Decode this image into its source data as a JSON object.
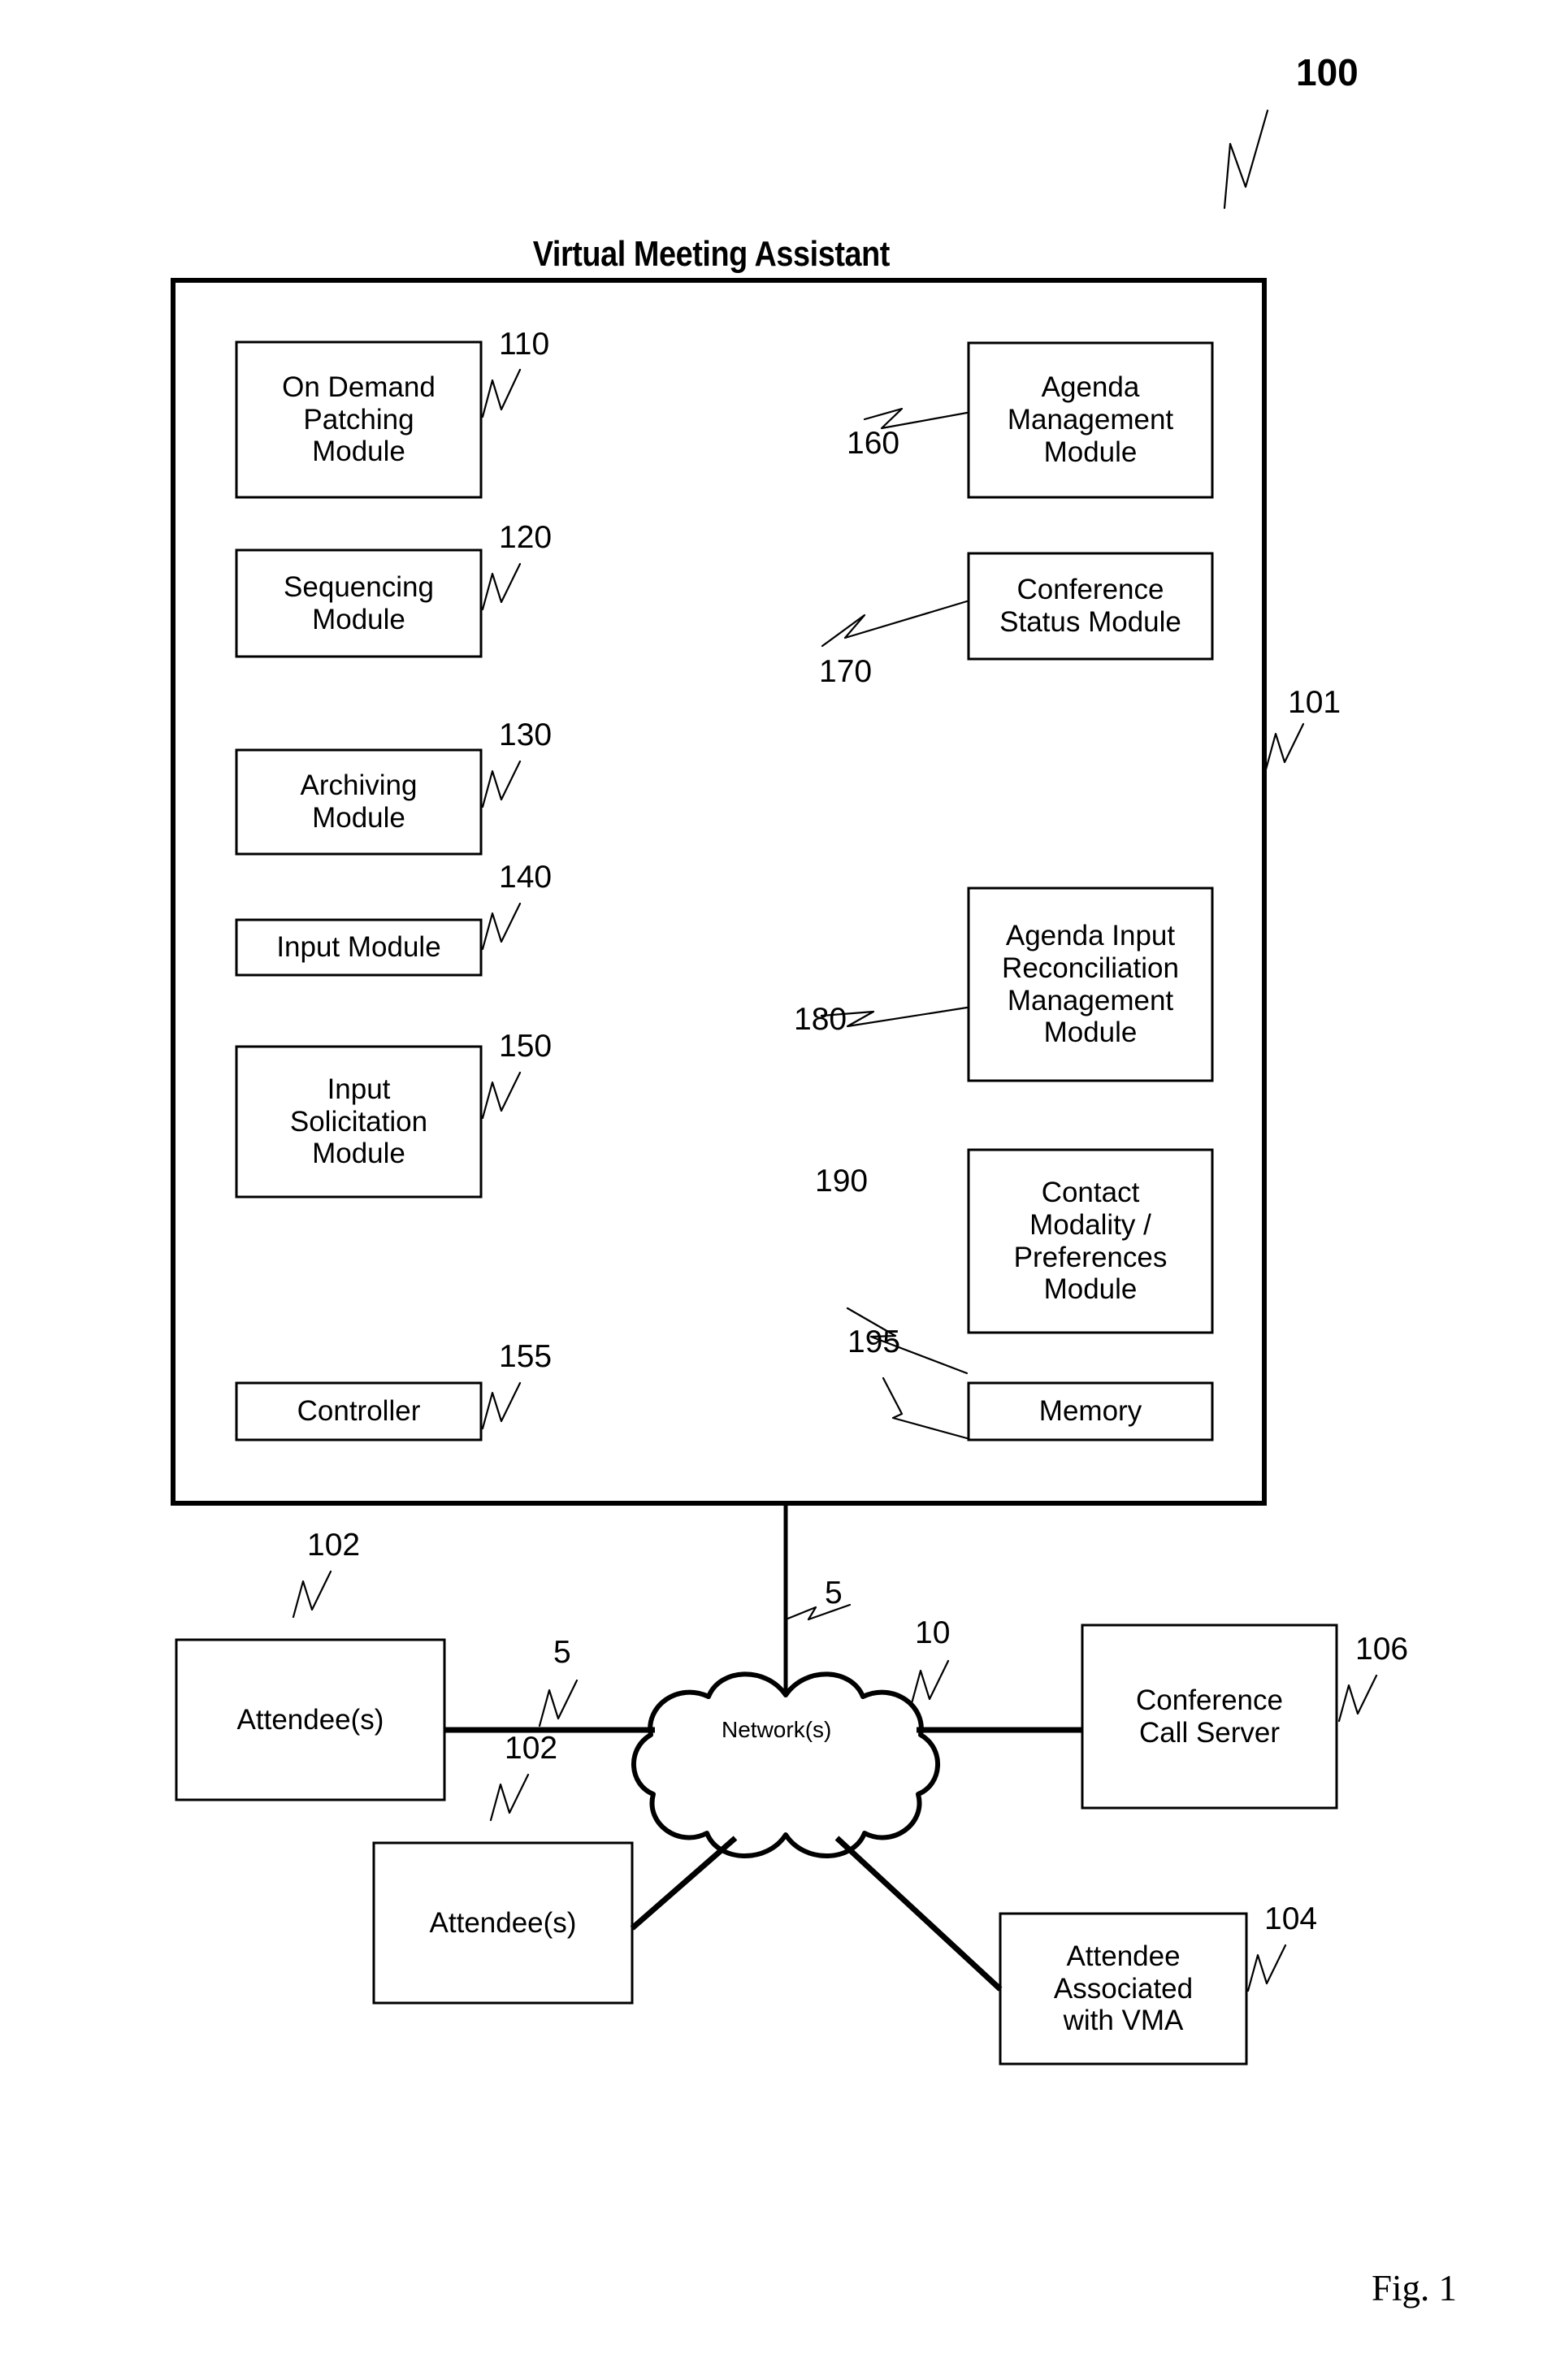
{
  "figure": {
    "caption": "Fig. 1",
    "system_ref": "100",
    "title": "Virtual Meeting Assistant"
  },
  "vma_frame": {
    "ref": "101"
  },
  "modules_left": [
    {
      "label": "On Demand\nPatching\nModule",
      "ref": "110"
    },
    {
      "label": "Sequencing\nModule",
      "ref": "120"
    },
    {
      "label": "Archiving\nModule",
      "ref": "130"
    },
    {
      "label": "Input Module",
      "ref": "140"
    },
    {
      "label": "Input\nSolicitation\nModule",
      "ref": "150"
    },
    {
      "label": "Controller",
      "ref": "155"
    }
  ],
  "modules_right": [
    {
      "label": "Agenda\nManagement\nModule",
      "ref": "160"
    },
    {
      "label": "Conference\nStatus Module",
      "ref": "170"
    },
    {
      "label": "Agenda Input\nReconciliation\nManagement\nModule",
      "ref": "180"
    },
    {
      "label": "Contact\nModality /\nPreferences\nModule",
      "ref": "190"
    },
    {
      "label": "Memory",
      "ref": "195"
    }
  ],
  "network": {
    "label": "Network(s)",
    "link_refs": {
      "vma_link": "5",
      "attendee_link": "5",
      "server_link": "10"
    }
  },
  "endpoints": [
    {
      "label": "Attendee(s)",
      "ref": "102"
    },
    {
      "label": "Attendee(s)",
      "ref": "102"
    },
    {
      "label": "Conference\nCall Server",
      "ref": "106"
    },
    {
      "label": "Attendee\nAssociated\nwith VMA",
      "ref": "104"
    }
  ],
  "colors": {
    "ink": "#000000",
    "paper": "#ffffff"
  }
}
